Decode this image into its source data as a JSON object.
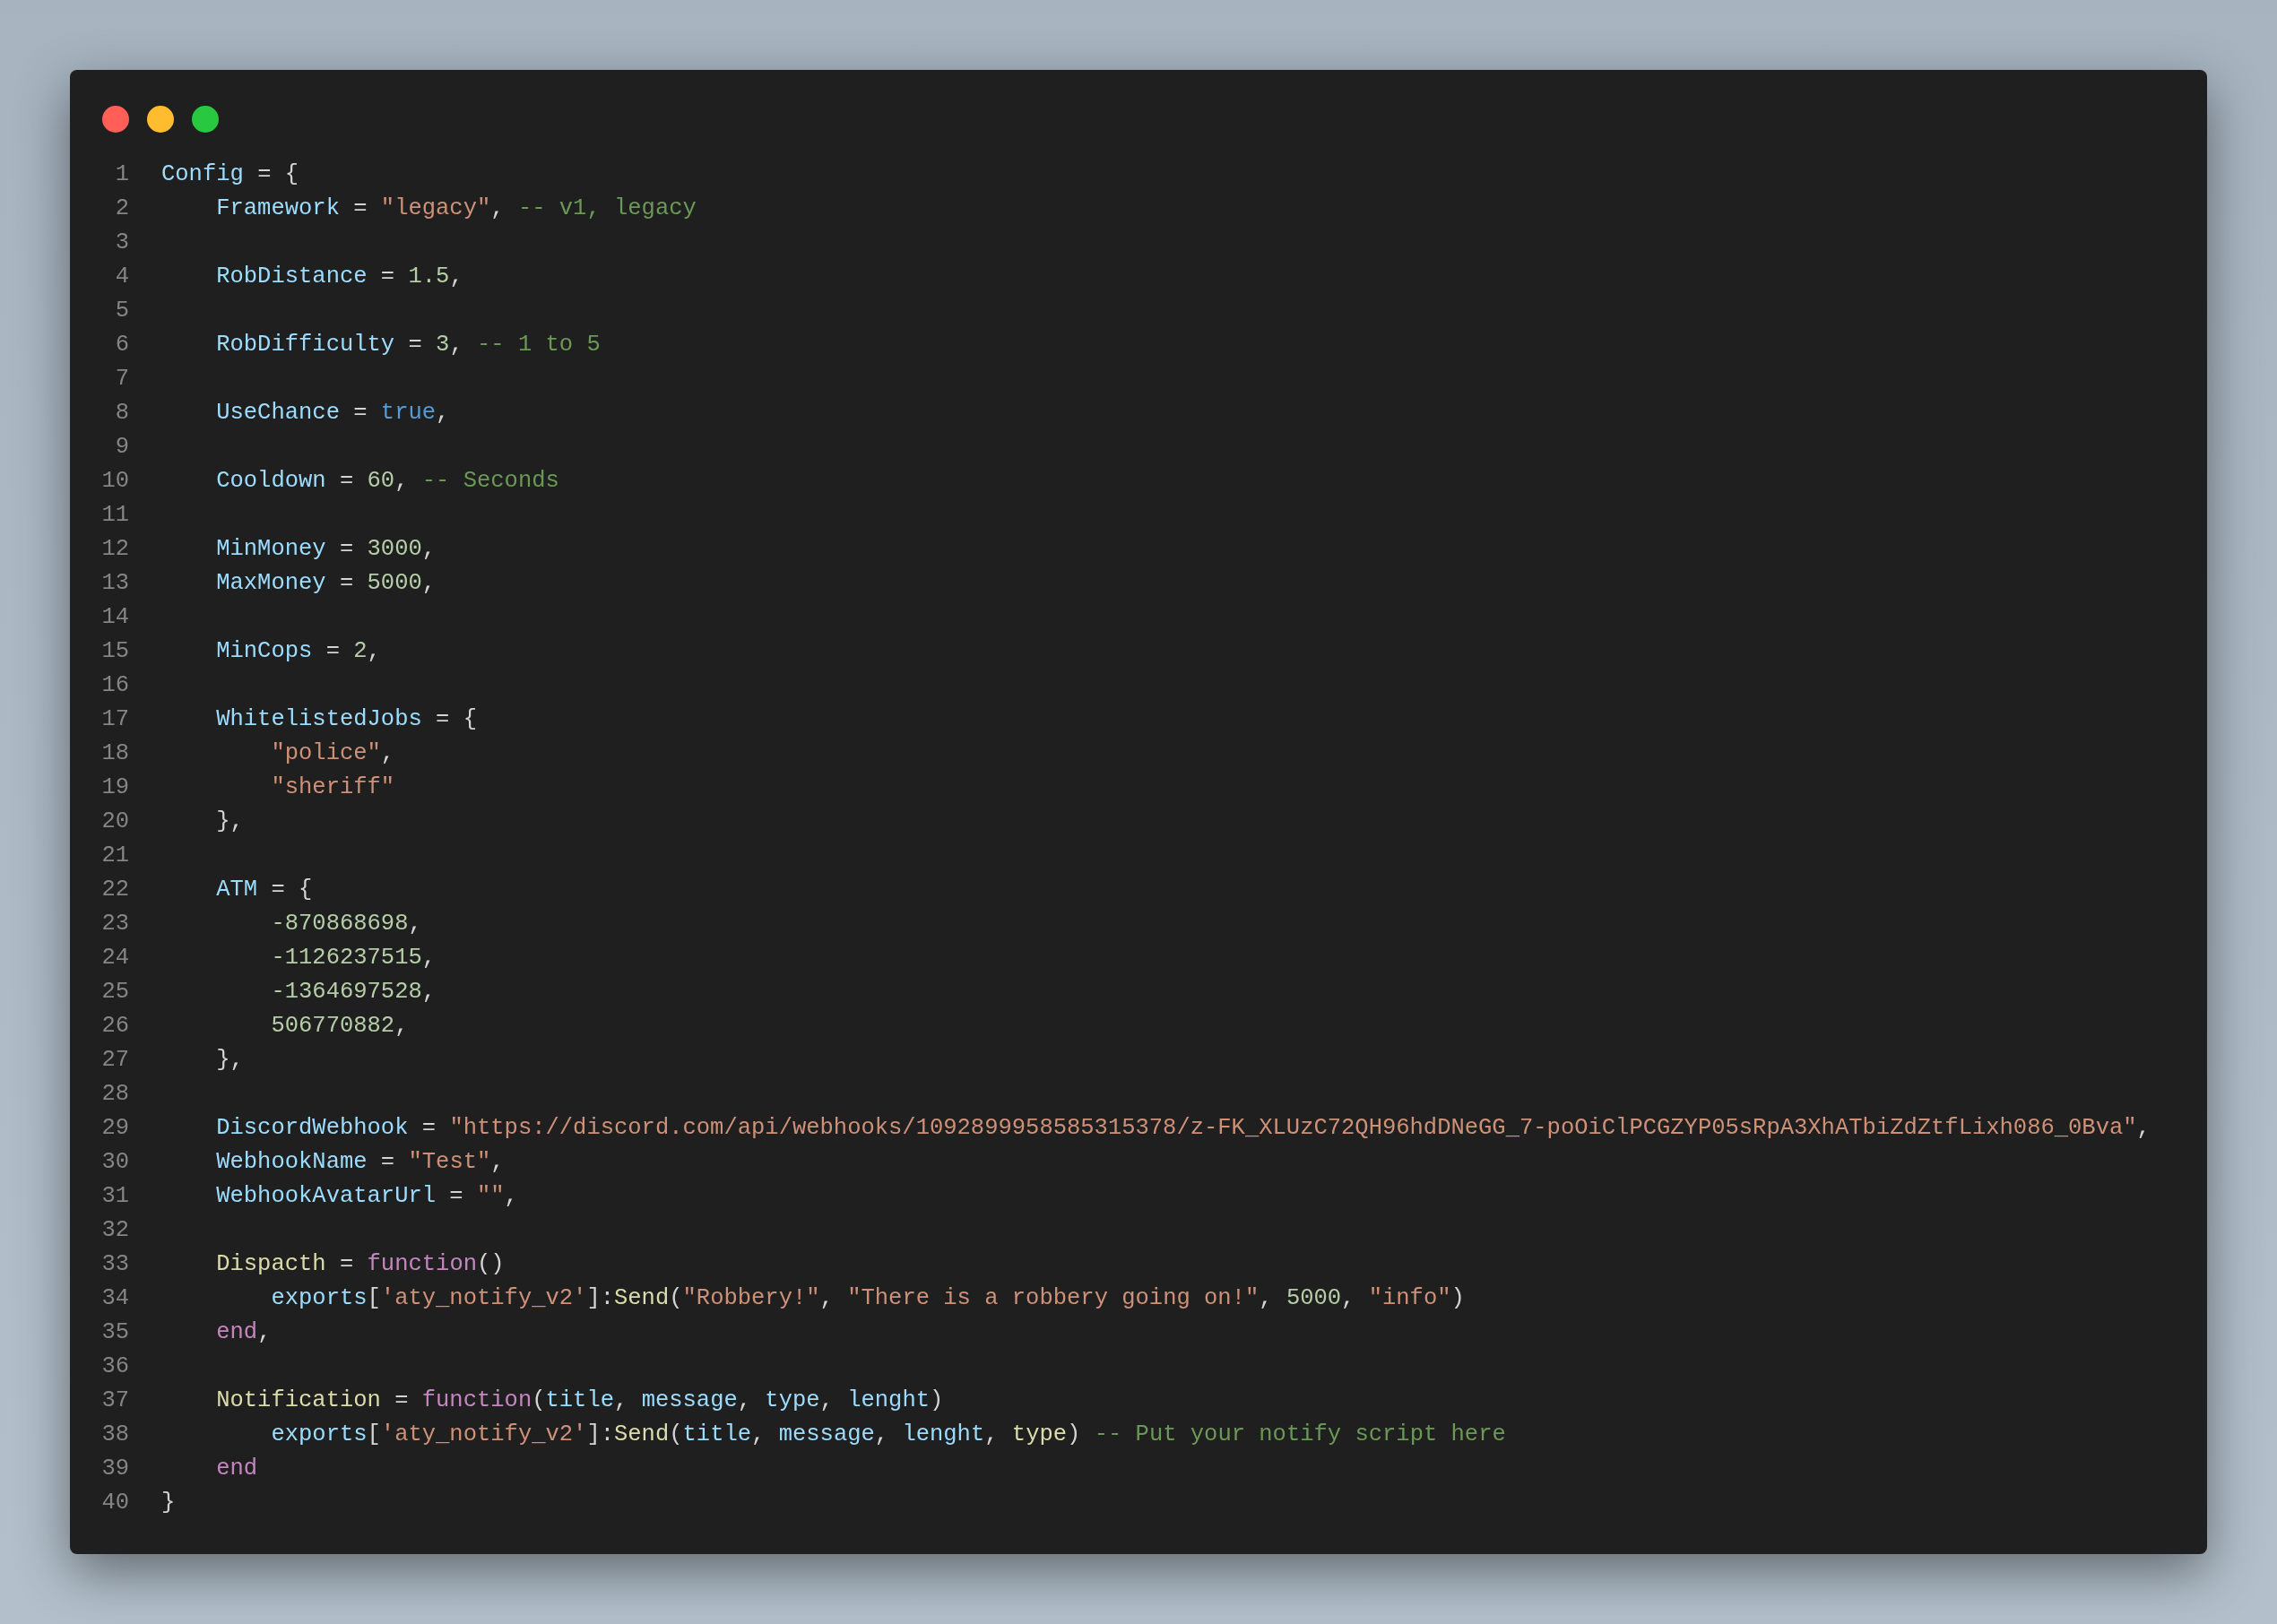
{
  "window": {
    "controls": [
      {
        "color": "#ff5f57"
      },
      {
        "color": "#febc2e"
      },
      {
        "color": "#28c840"
      }
    ]
  },
  "code": {
    "lines": [
      {
        "number": "1",
        "tokens": [
          {
            "kind": "variable",
            "text": "Config"
          },
          {
            "kind": "punct",
            "text": " = {"
          }
        ]
      },
      {
        "number": "2",
        "tokens": [
          {
            "kind": "variable",
            "text": "    Framework"
          },
          {
            "kind": "punct",
            "text": " = "
          },
          {
            "kind": "string",
            "text": "\"legacy\""
          },
          {
            "kind": "punct",
            "text": ", "
          },
          {
            "kind": "comment",
            "text": "-- v1, legacy"
          }
        ]
      },
      {
        "number": "3"
      },
      {
        "number": "4",
        "tokens": [
          {
            "kind": "variable",
            "text": "    RobDistance"
          },
          {
            "kind": "punct",
            "text": " = "
          },
          {
            "kind": "number",
            "text": "1.5"
          },
          {
            "kind": "punct",
            "text": ","
          }
        ]
      },
      {
        "number": "5"
      },
      {
        "number": "6",
        "tokens": [
          {
            "kind": "variable",
            "text": "    RobDifficulty"
          },
          {
            "kind": "punct",
            "text": " = "
          },
          {
            "kind": "number",
            "text": "3"
          },
          {
            "kind": "punct",
            "text": ", "
          },
          {
            "kind": "comment",
            "text": "-- 1 to 5"
          }
        ]
      },
      {
        "number": "7"
      },
      {
        "number": "8",
        "tokens": [
          {
            "kind": "variable",
            "text": "    UseChance"
          },
          {
            "kind": "punct",
            "text": " = "
          },
          {
            "kind": "boolean",
            "text": "true"
          },
          {
            "kind": "punct",
            "text": ","
          }
        ]
      },
      {
        "number": "9"
      },
      {
        "number": "10",
        "tokens": [
          {
            "kind": "variable",
            "text": "    Cooldown"
          },
          {
            "kind": "punct",
            "text": " = "
          },
          {
            "kind": "number",
            "text": "60"
          },
          {
            "kind": "punct",
            "text": ", "
          },
          {
            "kind": "comment",
            "text": "-- Seconds"
          }
        ]
      },
      {
        "number": "11"
      },
      {
        "number": "12",
        "tokens": [
          {
            "kind": "variable",
            "text": "    MinMoney"
          },
          {
            "kind": "punct",
            "text": " = "
          },
          {
            "kind": "number",
            "text": "3000"
          },
          {
            "kind": "punct",
            "text": ","
          }
        ]
      },
      {
        "number": "13",
        "tokens": [
          {
            "kind": "variable",
            "text": "    MaxMoney"
          },
          {
            "kind": "punct",
            "text": " = "
          },
          {
            "kind": "number",
            "text": "5000"
          },
          {
            "kind": "punct",
            "text": ","
          }
        ]
      },
      {
        "number": "14"
      },
      {
        "number": "15",
        "tokens": [
          {
            "kind": "variable",
            "text": "    MinCops"
          },
          {
            "kind": "punct",
            "text": " = "
          },
          {
            "kind": "number",
            "text": "2"
          },
          {
            "kind": "punct",
            "text": ","
          }
        ]
      },
      {
        "number": "16"
      },
      {
        "number": "17",
        "tokens": [
          {
            "kind": "variable",
            "text": "    WhitelistedJobs"
          },
          {
            "kind": "punct",
            "text": " = {"
          }
        ]
      },
      {
        "number": "18",
        "tokens": [
          {
            "kind": "string",
            "text": "        \"police\""
          },
          {
            "kind": "punct",
            "text": ","
          }
        ]
      },
      {
        "number": "19",
        "tokens": [
          {
            "kind": "string",
            "text": "        \"sheriff\""
          }
        ]
      },
      {
        "number": "20",
        "tokens": [
          {
            "kind": "punct",
            "text": "    },"
          }
        ]
      },
      {
        "number": "21"
      },
      {
        "number": "22",
        "tokens": [
          {
            "kind": "variable",
            "text": "    ATM"
          },
          {
            "kind": "punct",
            "text": " = {"
          }
        ]
      },
      {
        "number": "23",
        "tokens": [
          {
            "kind": "number",
            "text": "        -870868698"
          },
          {
            "kind": "punct",
            "text": ","
          }
        ]
      },
      {
        "number": "24",
        "tokens": [
          {
            "kind": "number",
            "text": "        -1126237515"
          },
          {
            "kind": "punct",
            "text": ","
          }
        ]
      },
      {
        "number": "25",
        "tokens": [
          {
            "kind": "number",
            "text": "        -1364697528"
          },
          {
            "kind": "punct",
            "text": ","
          }
        ]
      },
      {
        "number": "26",
        "tokens": [
          {
            "kind": "number",
            "text": "        506770882"
          },
          {
            "kind": "punct",
            "text": ","
          }
        ]
      },
      {
        "number": "27",
        "tokens": [
          {
            "kind": "punct",
            "text": "    },"
          }
        ]
      },
      {
        "number": "28"
      },
      {
        "number": "29",
        "tokens": [
          {
            "kind": "variable",
            "text": "    DiscordWebhook"
          },
          {
            "kind": "punct",
            "text": " = "
          },
          {
            "kind": "string",
            "text": "\"https://discord.com/api/webhooks/1092899958585315378/z-FK_XLUzC72QH96hdDNeGG_7-poOiClPCGZYP05sRpA3XhATbiZdZtfLixh086_0Bva\""
          },
          {
            "kind": "punct",
            "text": ","
          }
        ]
      },
      {
        "number": "30",
        "tokens": [
          {
            "kind": "variable",
            "text": "    WebhookName"
          },
          {
            "kind": "punct",
            "text": " = "
          },
          {
            "kind": "string",
            "text": "\"Test\""
          },
          {
            "kind": "punct",
            "text": ","
          }
        ]
      },
      {
        "number": "31",
        "tokens": [
          {
            "kind": "variable",
            "text": "    WebhookAvatarUrl"
          },
          {
            "kind": "punct",
            "text": " = "
          },
          {
            "kind": "string",
            "text": "\"\""
          },
          {
            "kind": "punct",
            "text": ","
          }
        ]
      },
      {
        "number": "32"
      },
      {
        "number": "33",
        "tokens": [
          {
            "kind": "function",
            "text": "    Dispacth"
          },
          {
            "kind": "punct",
            "text": " = "
          },
          {
            "kind": "keyword",
            "text": "function"
          },
          {
            "kind": "punct",
            "text": "()"
          }
        ]
      },
      {
        "number": "34",
        "tokens": [
          {
            "kind": "variable",
            "text": "        exports"
          },
          {
            "kind": "punct",
            "text": "["
          },
          {
            "kind": "string",
            "text": "'aty_notify_v2'"
          },
          {
            "kind": "punct",
            "text": "]:"
          },
          {
            "kind": "function",
            "text": "Send"
          },
          {
            "kind": "punct",
            "text": "("
          },
          {
            "kind": "string",
            "text": "\"Robbery!\""
          },
          {
            "kind": "punct",
            "text": ", "
          },
          {
            "kind": "string",
            "text": "\"There is a robbery going on!\""
          },
          {
            "kind": "punct",
            "text": ", "
          },
          {
            "kind": "number",
            "text": "5000"
          },
          {
            "kind": "punct",
            "text": ", "
          },
          {
            "kind": "string",
            "text": "\"info\""
          },
          {
            "kind": "punct",
            "text": ")"
          }
        ]
      },
      {
        "number": "35",
        "tokens": [
          {
            "kind": "keyword",
            "text": "    end"
          },
          {
            "kind": "punct",
            "text": ","
          }
        ]
      },
      {
        "number": "36"
      },
      {
        "number": "37",
        "tokens": [
          {
            "kind": "function",
            "text": "    Notification"
          },
          {
            "kind": "punct",
            "text": " = "
          },
          {
            "kind": "keyword",
            "text": "function"
          },
          {
            "kind": "punct",
            "text": "("
          },
          {
            "kind": "variable",
            "text": "title"
          },
          {
            "kind": "punct",
            "text": ", "
          },
          {
            "kind": "variable",
            "text": "message"
          },
          {
            "kind": "punct",
            "text": ", "
          },
          {
            "kind": "variable",
            "text": "type"
          },
          {
            "kind": "punct",
            "text": ", "
          },
          {
            "kind": "variable",
            "text": "lenght"
          },
          {
            "kind": "punct",
            "text": ")"
          }
        ]
      },
      {
        "number": "38",
        "tokens": [
          {
            "kind": "variable",
            "text": "        exports"
          },
          {
            "kind": "punct",
            "text": "["
          },
          {
            "kind": "string",
            "text": "'aty_notify_v2'"
          },
          {
            "kind": "punct",
            "text": "]:"
          },
          {
            "kind": "function",
            "text": "Send"
          },
          {
            "kind": "punct",
            "text": "("
          },
          {
            "kind": "variable",
            "text": "title"
          },
          {
            "kind": "punct",
            "text": ", "
          },
          {
            "kind": "variable",
            "text": "message"
          },
          {
            "kind": "punct",
            "text": ", "
          },
          {
            "kind": "variable",
            "text": "lenght"
          },
          {
            "kind": "punct",
            "text": ", "
          },
          {
            "kind": "function",
            "text": "type"
          },
          {
            "kind": "punct",
            "text": ") "
          },
          {
            "kind": "comment",
            "text": "-- Put your notify script here"
          }
        ]
      },
      {
        "number": "39",
        "tokens": [
          {
            "kind": "keyword",
            "text": "    end"
          }
        ]
      },
      {
        "number": "40",
        "tokens": [
          {
            "kind": "punct",
            "text": "}"
          }
        ]
      }
    ]
  }
}
